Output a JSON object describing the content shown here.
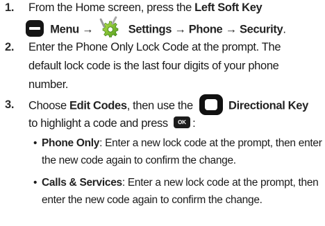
{
  "steps": [
    {
      "number": "1.",
      "lead_1": "From the Home screen, press the ",
      "left_soft_key": "Left Soft Key",
      "menu": "Menu",
      "arrow_1": "→",
      "settings": "Settings",
      "arrow_2": "→",
      "phone": "Phone",
      "arrow_3": "→",
      "security": "Security",
      "end": ".",
      "icons": [
        "left-soft-key-icon",
        "settings-icon"
      ]
    },
    {
      "number": "2.",
      "line_1": "Enter the Phone Only Lock Code at the prompt. The",
      "line_2": "default lock code is the last four digits of your phone",
      "line_3": "number."
    },
    {
      "number": "3.",
      "lead_1": "Choose ",
      "edit_codes": "Edit Codes",
      "mid_1": ", then use the ",
      "directional_key": "Directional Key",
      "line_2_text": "to highlight a code and press ",
      "ok_label": "OK",
      "end": ":",
      "icons": [
        "directional-key-icon",
        "ok-key-icon"
      ]
    }
  ],
  "bullets": [
    {
      "marker": "•",
      "term": "Phone Only",
      "rest_1": ": Enter a new lock code at the prompt, then enter",
      "line_2": "the new code again to confirm the change."
    },
    {
      "marker": "•",
      "term": "Calls & Services",
      "rest_1": ": Enter a new lock code at the prompt, then",
      "line_2": "enter the new code again to confirm the change."
    }
  ]
}
